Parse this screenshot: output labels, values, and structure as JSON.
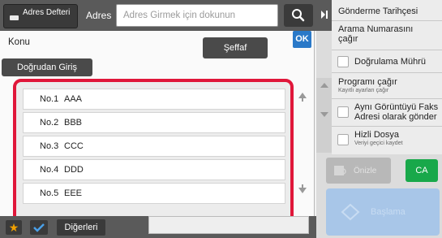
{
  "header": {
    "address_book_label": "Adres Defteri",
    "address_label": "Adres",
    "address_placeholder": "Adres Girmek için dokunun"
  },
  "dialog": {
    "title": "Konu",
    "ok_label": "OK",
    "clear_label": "Şeffaf",
    "direct_entry_label": "Doğrudan Giriş",
    "items": [
      {
        "number": "No.1",
        "name": "AAA"
      },
      {
        "number": "No.2",
        "name": "BBB"
      },
      {
        "number": "No.3",
        "name": "CCC"
      },
      {
        "number": "No.4",
        "name": "DDD"
      },
      {
        "number": "No.5",
        "name": "EEE"
      }
    ]
  },
  "sidebar": {
    "send_history": "Gönderme Tarihçesi",
    "recall_number": "Arama Numarasını çağır",
    "verification_stamp": "Doğrulama Mührü",
    "recall_program": "Programı çağır",
    "recall_program_sub": "Kayıtlı ayarları çağır",
    "same_image_fax": "Aynı Görüntüyü Faks Adresi olarak gönder",
    "quick_file": "Hizli Dosya",
    "quick_file_sub": "Veriyi geçici kaydet"
  },
  "buttons": {
    "preview": "Önizle",
    "ca": "CA",
    "start": "Başlama",
    "others": "Diğerleri"
  },
  "icons": {
    "address_book": "address-book-icon",
    "search": "search-icon",
    "star": "star-icon",
    "check": "check-icon",
    "collapse": "collapse-arrow-icon"
  },
  "colors": {
    "highlight_frame": "#e0173a",
    "ok_blue": "#2a79c8",
    "ca_green": "#18a84a",
    "star_orange": "#f0a000",
    "start_blue": "#a8c6e8"
  }
}
